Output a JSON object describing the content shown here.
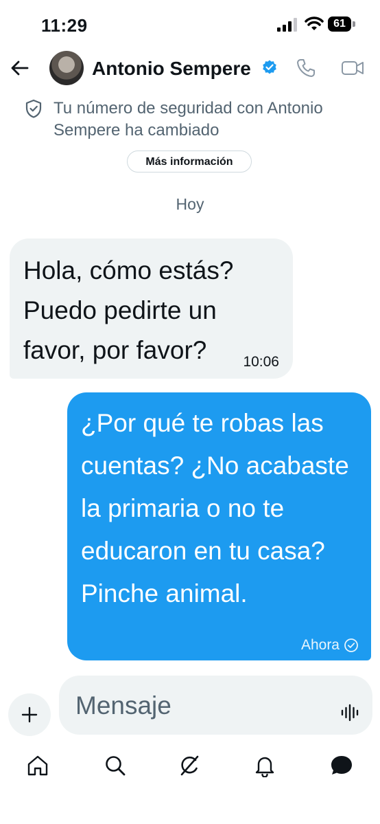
{
  "status_bar": {
    "time": "11:29",
    "battery": "61"
  },
  "header": {
    "contact_name": "Antonio Sempere",
    "verified": true,
    "icons": [
      "back-arrow-icon",
      "verified-badge-icon",
      "phone-icon",
      "video-camera-icon"
    ]
  },
  "security_notice": {
    "text": "Tu número de seguridad con Antonio Sempere ha cambiado",
    "button_label": "Más información"
  },
  "date_separator": "Hoy",
  "messages": [
    {
      "direction": "incoming",
      "text": "Hola, cómo estás? Puedo pedirte un favor, por favor?",
      "time": "10:06"
    },
    {
      "direction": "outgoing",
      "text": "¿Por qué te robas las cuentas? ¿No acabaste la primaria o no te educaron en tu casa? Pinche animal.",
      "time": "Ahora",
      "status": "sent"
    }
  ],
  "composer": {
    "placeholder": "Mensaje"
  },
  "tab_bar": {
    "items": [
      "home-icon",
      "search-icon",
      "grok-icon",
      "notifications-icon",
      "messages-icon"
    ],
    "active": "messages-icon"
  },
  "colors": {
    "accent": "#1d9bf0",
    "incoming_bubble": "#eff3f4",
    "secondary_text": "#536471"
  }
}
